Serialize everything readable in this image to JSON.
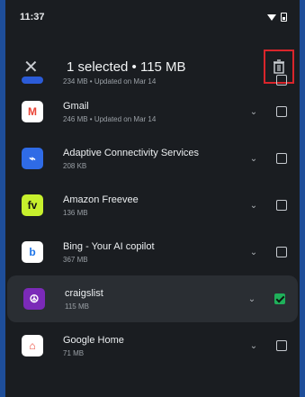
{
  "status": {
    "time": "11:37"
  },
  "appbar": {
    "title": "1 selected • 115 MB"
  },
  "apps": [
    {
      "name": "",
      "meta": "234 MB • Updated on Mar 14",
      "checked": false,
      "icon": "partial-icon",
      "color": "#2b5bd7"
    },
    {
      "name": "Gmail",
      "meta": "246 MB • Updated on Mar 14",
      "checked": false,
      "icon": "gmail-icon",
      "color": "#ffffff"
    },
    {
      "name": "Adaptive Connectivity Services",
      "meta": "208 KB",
      "checked": false,
      "icon": "adaptive-connectivity-icon",
      "color": "#2f6be6"
    },
    {
      "name": "Amazon Freevee",
      "meta": "136 MB",
      "checked": false,
      "icon": "freevee-icon",
      "color": "#c7f02d"
    },
    {
      "name": "Bing - Your AI copilot",
      "meta": "367 MB",
      "checked": false,
      "icon": "bing-icon",
      "color": "#ffffff"
    },
    {
      "name": "craigslist",
      "meta": "115 MB",
      "checked": true,
      "icon": "craigslist-icon",
      "color": "#7b2ab8"
    },
    {
      "name": "Google Home",
      "meta": "71 MB",
      "checked": false,
      "icon": "google-home-icon",
      "color": "#ffffff"
    }
  ]
}
